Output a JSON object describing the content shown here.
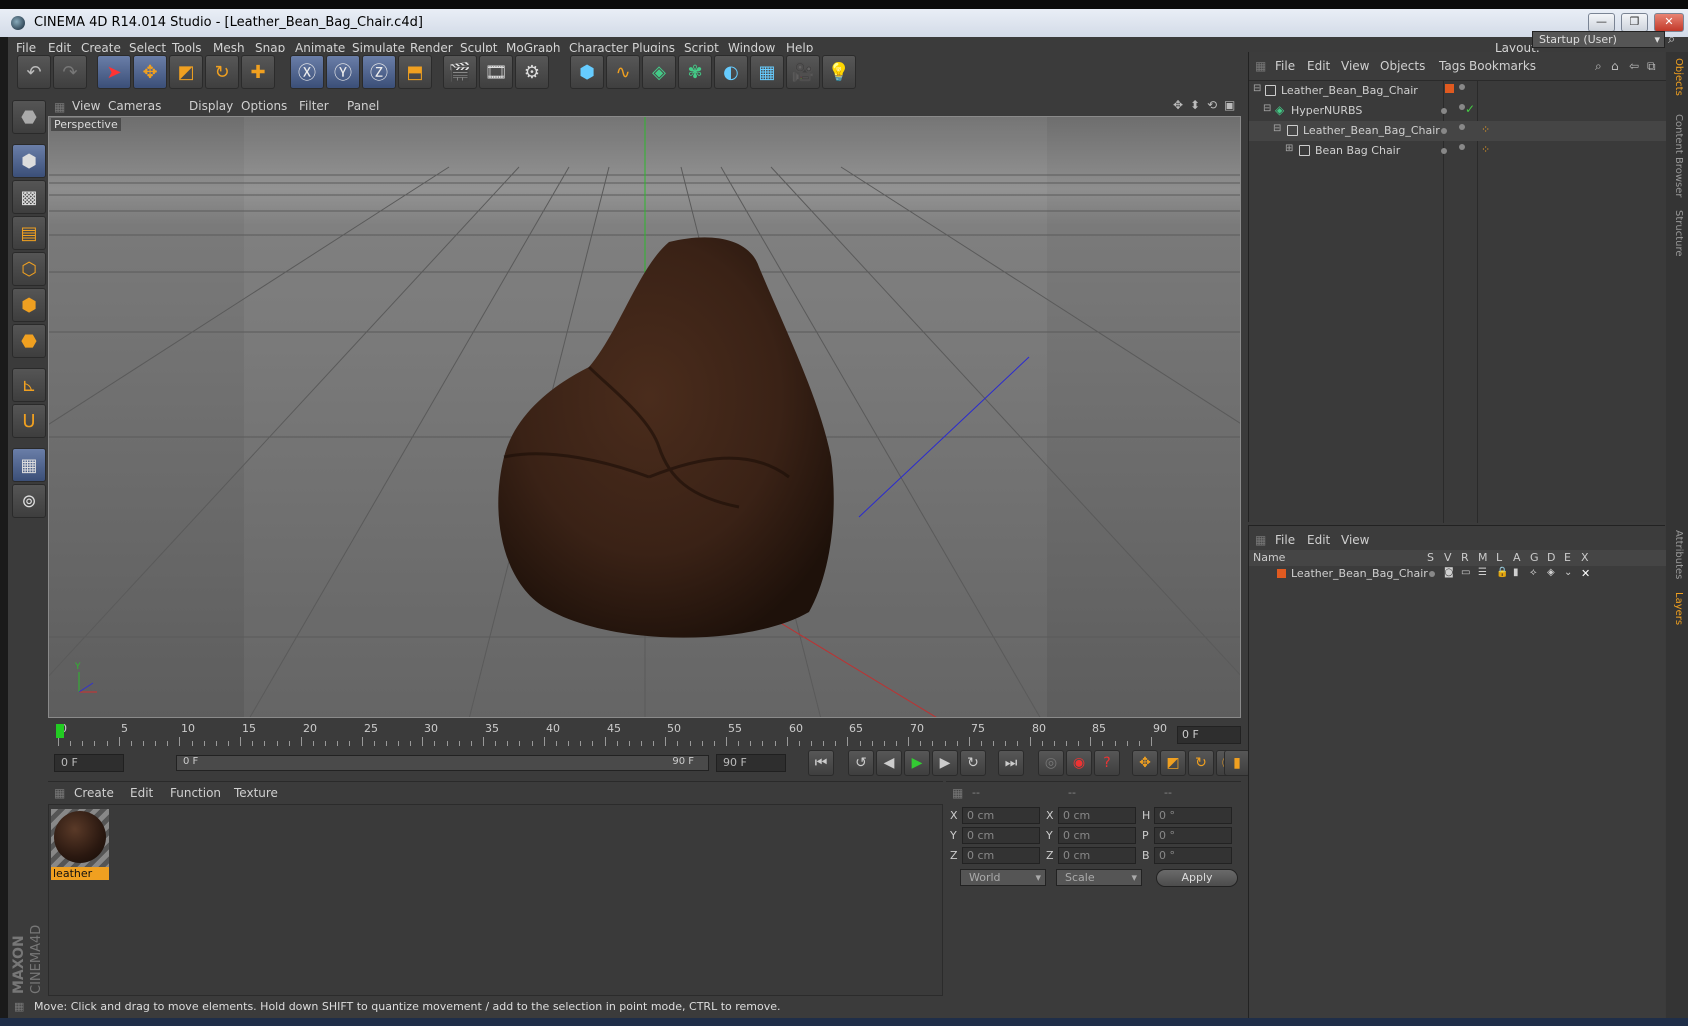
{
  "window": {
    "title": "CINEMA 4D R14.014 Studio - [Leather_Bean_Bag_Chair.c4d]",
    "btn_min": "—",
    "btn_max": "❐",
    "btn_close": "✕"
  },
  "menu": [
    "File",
    "Edit",
    "Create",
    "Select",
    "Tools",
    "Mesh",
    "Snap",
    "Animate",
    "Simulate",
    "Render",
    "Sculpt",
    "MoGraph",
    "Character",
    "Plugins",
    "Script",
    "Window",
    "Help"
  ],
  "layout": {
    "label": "Layout:",
    "value": "Startup (User)"
  },
  "viewport": {
    "menu": [
      "View",
      "Cameras",
      "Display",
      "Options",
      "Filter",
      "Panel"
    ],
    "label": "Perspective",
    "axis_y": "Y"
  },
  "timeline": {
    "ticks": [
      "0",
      "5",
      "10",
      "15",
      "20",
      "25",
      "30",
      "35",
      "40",
      "45",
      "50",
      "55",
      "60",
      "65",
      "70",
      "75",
      "80",
      "85",
      "90"
    ],
    "current_frame": "0 F",
    "start_field": "0 F",
    "range_start": "0 F",
    "range_end": "90 F",
    "end_field": "90 F"
  },
  "materials": {
    "menu": [
      "Create",
      "Edit",
      "Function",
      "Texture"
    ],
    "items": [
      {
        "name": "leather"
      }
    ]
  },
  "coords": {
    "headers": [
      "--",
      "--",
      "--"
    ],
    "rows": [
      {
        "l1": "X",
        "v1": "0 cm",
        "l2": "X",
        "v2": "0 cm",
        "l3": "H",
        "v3": "0 °"
      },
      {
        "l1": "Y",
        "v1": "0 cm",
        "l2": "Y",
        "v2": "0 cm",
        "l3": "P",
        "v3": "0 °"
      },
      {
        "l1": "Z",
        "v1": "0 cm",
        "l2": "Z",
        "v2": "0 cm",
        "l3": "B",
        "v3": "0 °"
      }
    ],
    "mode1": "World",
    "mode2": "Scale",
    "apply": "Apply"
  },
  "objects": {
    "menu": [
      "File",
      "Edit",
      "View",
      "Objects",
      "Tags",
      "Bookmarks"
    ],
    "tree": [
      {
        "name": "Leather_Bean_Bag_Chair",
        "indent": 0
      },
      {
        "name": "HyperNURBS",
        "indent": 1
      },
      {
        "name": "Leather_Bean_Bag_Chair",
        "indent": 2
      },
      {
        "name": "Bean Bag Chair",
        "indent": 3
      }
    ]
  },
  "layers": {
    "menu": [
      "File",
      "Edit",
      "View"
    ],
    "columns": [
      "Name",
      "S",
      "V",
      "R",
      "M",
      "L",
      "A",
      "G",
      "D",
      "E",
      "X"
    ],
    "rows": [
      {
        "name": "Leather_Bean_Bag_Chair"
      }
    ]
  },
  "right_tabs": [
    "Objects",
    "Content Browser",
    "Structure",
    "Attributes",
    "Layers"
  ],
  "status": "Move: Click and drag to move elements. Hold down SHIFT to quantize movement / add to the selection in point mode, CTRL to remove.",
  "brand": {
    "line1": "MAXON",
    "line2": "CINEMA4D"
  },
  "colors": {
    "accent": "#f0a020",
    "viewport_bg": "#6b6b6b",
    "chair": "#3a2216"
  }
}
